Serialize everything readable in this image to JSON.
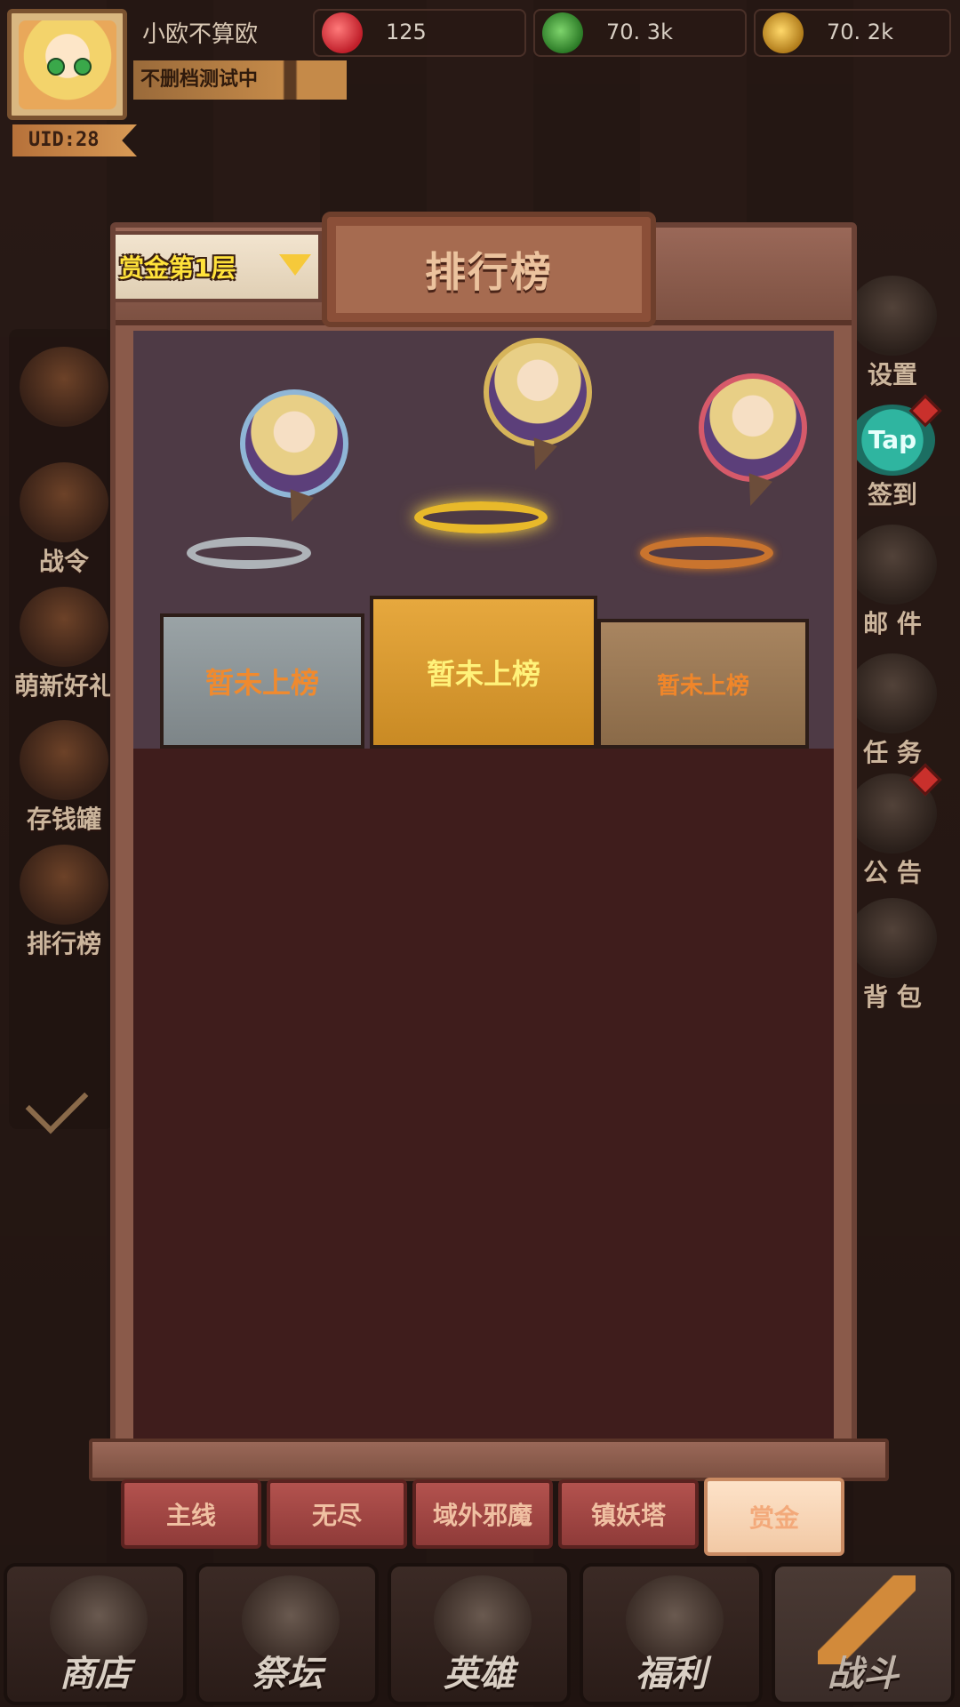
{
  "hud": {
    "player_name": "小欧不算欧",
    "server_tag": "不删档测试中",
    "uid": "UID:28",
    "resources": [
      {
        "icon": "apple-icon",
        "value": "125"
      },
      {
        "icon": "green-gem-icon",
        "value": "70. 3k"
      },
      {
        "icon": "coin-icon",
        "value": "70. 2k"
      }
    ]
  },
  "left_menu": [
    {
      "icon": "refresh-icon",
      "label": ""
    },
    {
      "icon": "battle-pass-icon",
      "label": "战令"
    },
    {
      "icon": "gift-box-icon",
      "label": "萌新好礼"
    },
    {
      "icon": "piggy-bank-icon",
      "label": "存钱罐"
    },
    {
      "icon": "ranking-icon",
      "label": "排行榜"
    }
  ],
  "right_menu": [
    {
      "icon": "gear-icon",
      "label": "设置",
      "badge": false
    },
    {
      "icon": "tap-icon",
      "label": "签到",
      "badge": true,
      "icon_text": "Tap"
    },
    {
      "icon": "mail-icon",
      "label": "邮 件",
      "badge": false
    },
    {
      "icon": "scroll-icon",
      "label": "任 务",
      "badge": false
    },
    {
      "icon": "megaphone-icon",
      "label": "公 告",
      "badge": true
    },
    {
      "icon": "backpack-icon",
      "label": "背 包",
      "badge": false
    }
  ],
  "panel": {
    "title": "排行榜",
    "tier_select": "赏金第1层",
    "podium": {
      "first": {
        "status": "暂未上榜"
      },
      "second": {
        "status": "暂未上榜"
      },
      "third": {
        "status": "暂未上榜"
      }
    }
  },
  "tabs": [
    {
      "label": "主线",
      "active": false
    },
    {
      "label": "无尽",
      "active": false
    },
    {
      "label": "域外邪魔",
      "active": false
    },
    {
      "label": "镇妖塔",
      "active": false
    },
    {
      "label": "赏金",
      "active": true
    }
  ],
  "bottom_nav": [
    {
      "label": "商店",
      "icon": "shop-icon"
    },
    {
      "label": "祭坛",
      "icon": "altar-icon"
    },
    {
      "label": "英雄",
      "icon": "hero-icon"
    },
    {
      "label": "福利",
      "icon": "welfare-icon"
    },
    {
      "label": "战斗",
      "icon": "battle-icon"
    }
  ]
}
